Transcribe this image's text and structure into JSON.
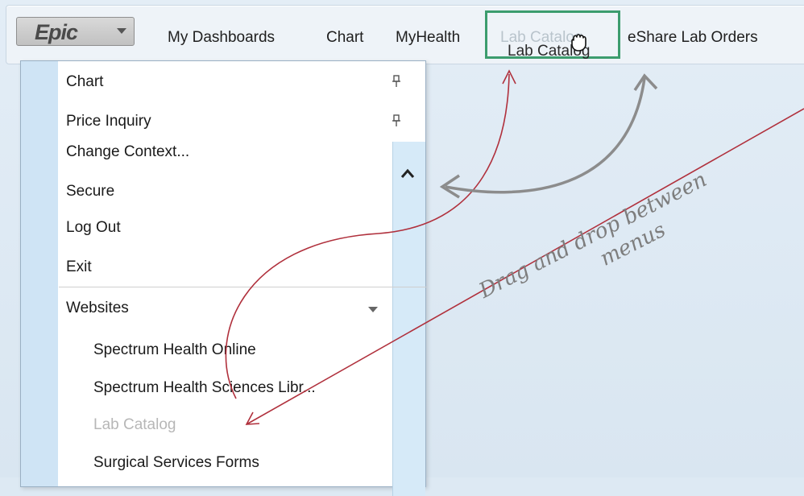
{
  "toolbar": {
    "epic_label": "Epic",
    "nav": [
      {
        "label": "My Dashboards"
      },
      {
        "label": "Chart"
      },
      {
        "label": "MyHealth"
      },
      {
        "label": "Lab Catalog"
      },
      {
        "label": "eShare Lab Orders"
      }
    ],
    "drag_label": "Lab Catalog"
  },
  "menu": {
    "pinned": [
      {
        "label": "Chart"
      },
      {
        "label": "Price Inquiry"
      }
    ],
    "actions": [
      {
        "label": "Change Context..."
      },
      {
        "label": "Secure"
      },
      {
        "label": "Log Out"
      },
      {
        "label": "Exit"
      }
    ],
    "websites": {
      "label": "Websites",
      "items": [
        {
          "label": "Spectrum Health Online"
        },
        {
          "label": "Spectrum Health Sciences Libr..."
        },
        {
          "label": "Lab Catalog"
        },
        {
          "label": "Surgical Services Forms"
        }
      ]
    }
  },
  "annotation": {
    "line1": "Drag and drop between",
    "line2": "menus"
  },
  "colors": {
    "highlight_box": "#3c9c6e",
    "arrow_red": "#b0303c",
    "arrow_gray": "#8c8c8c",
    "menu_strip": "#cfe4f5"
  },
  "icons": {
    "epic_caret": "chevron-down-icon",
    "pin": "pin-icon",
    "scroll_up": "chevron-up-icon",
    "cursor": "hand-grab-icon"
  }
}
